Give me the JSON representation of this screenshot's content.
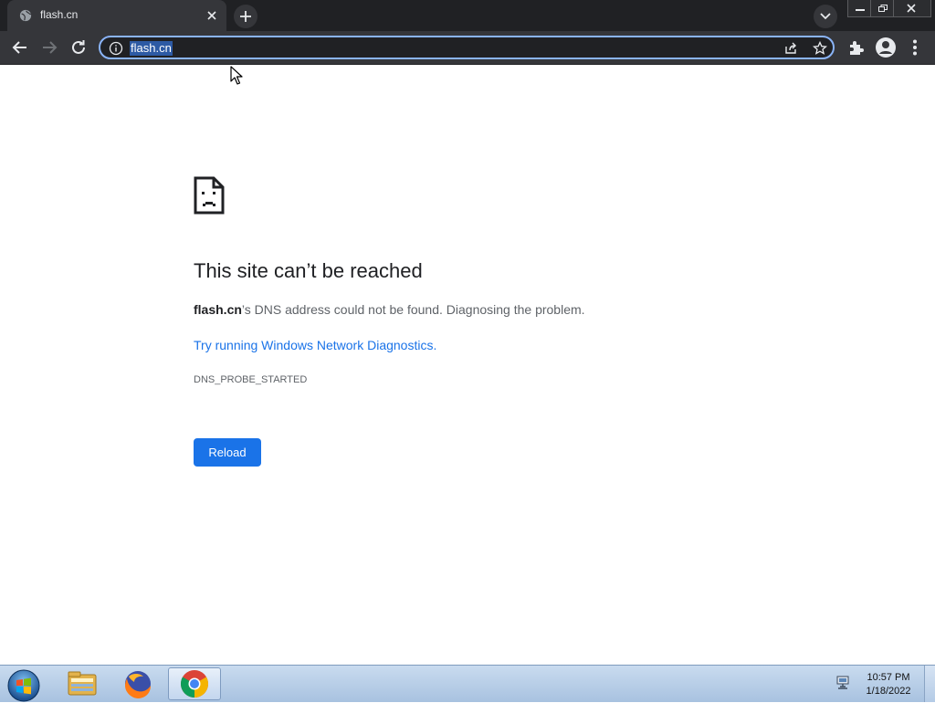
{
  "browser": {
    "tab": {
      "title": "flash.cn"
    },
    "address_bar": {
      "url": "flash.cn"
    }
  },
  "error_page": {
    "title": "This site can’t be reached",
    "domain": "flash.cn",
    "message_suffix": "’s DNS address could not be found. Diagnosing the problem.",
    "link": "Try running Windows Network Diagnostics.",
    "error_code": "DNS_PROBE_STARTED",
    "reload_label": "Reload"
  },
  "taskbar": {
    "pinned": [
      "windows-explorer",
      "firefox",
      "chrome"
    ],
    "clock": {
      "time": "10:57 PM",
      "date": "1/18/2022"
    }
  },
  "colors": {
    "accent": "#1a73e8",
    "tabstrip": "#202124",
    "toolbar": "#35363a",
    "focus_ring": "#8ab4f8"
  }
}
